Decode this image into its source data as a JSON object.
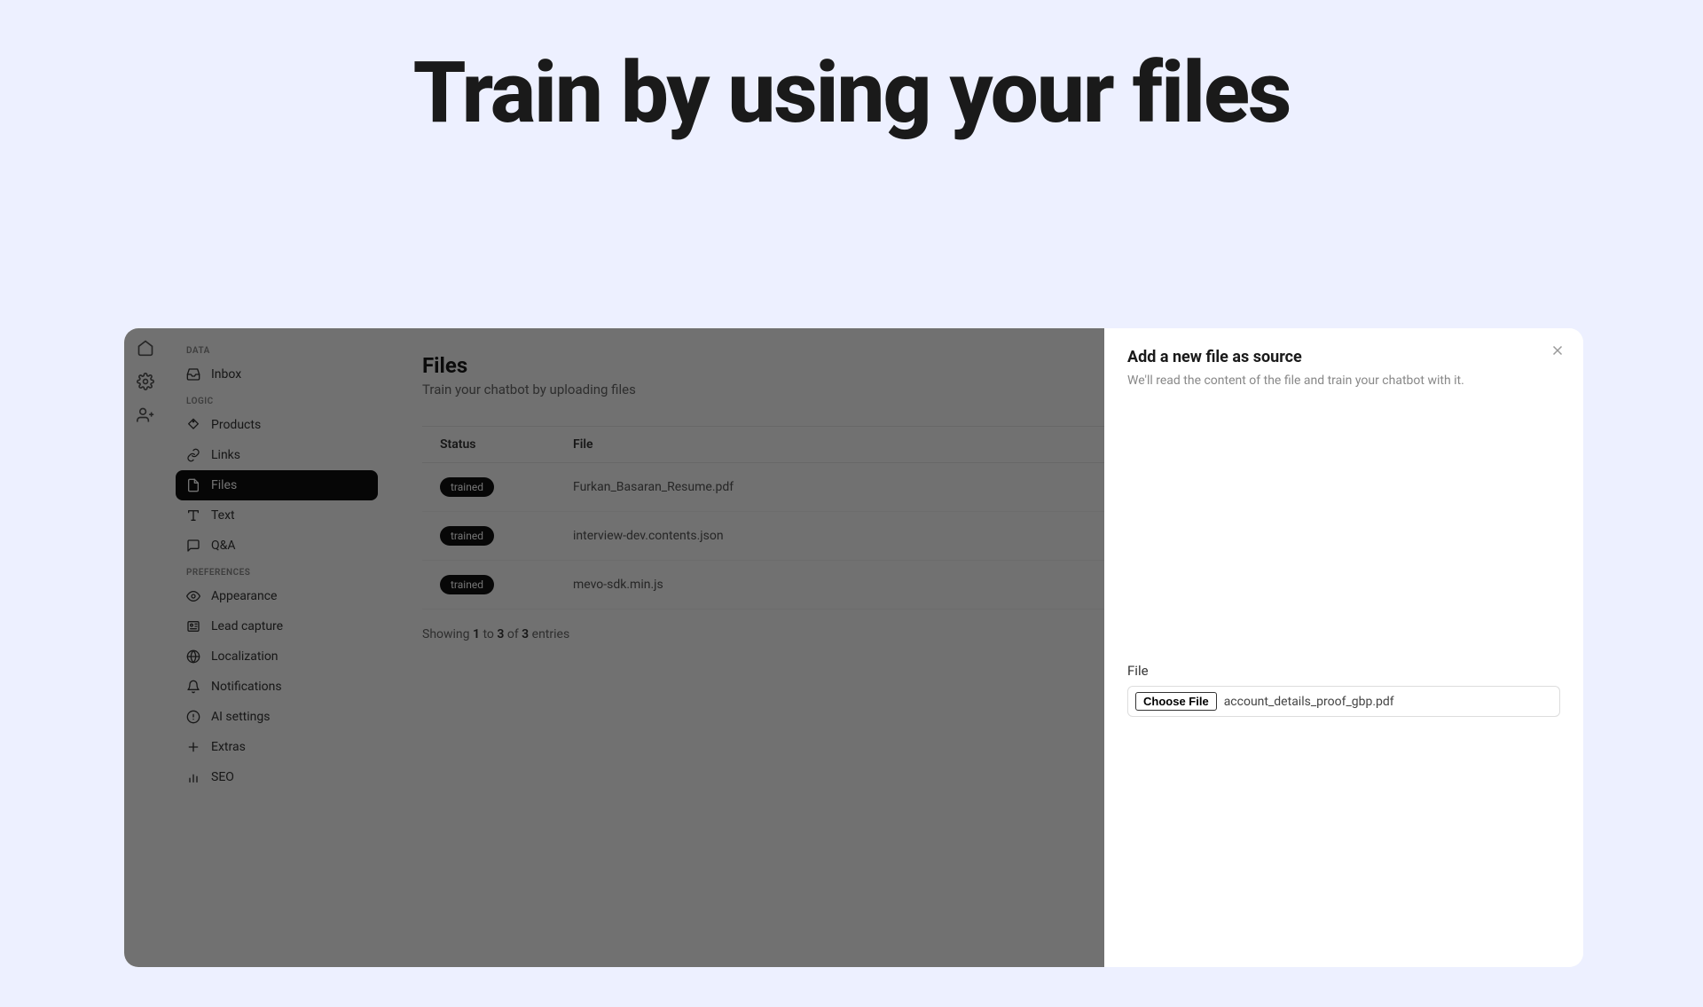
{
  "hero": {
    "title": "Train by using your files"
  },
  "rail": {
    "icons": [
      "home",
      "gear",
      "user-plus"
    ]
  },
  "sidebar": {
    "sections": [
      {
        "label": "DATA",
        "items": [
          {
            "icon": "inbox",
            "label": "Inbox",
            "active": false
          }
        ]
      },
      {
        "label": "LOGIC",
        "items": [
          {
            "icon": "tag",
            "label": "Products",
            "active": false
          },
          {
            "icon": "link",
            "label": "Links",
            "active": false
          },
          {
            "icon": "file",
            "label": "Files",
            "active": true
          },
          {
            "icon": "type",
            "label": "Text",
            "active": false
          },
          {
            "icon": "chat",
            "label": "Q&A",
            "active": false
          }
        ]
      },
      {
        "label": "PREFERENCES",
        "items": [
          {
            "icon": "eye",
            "label": "Appearance",
            "active": false
          },
          {
            "icon": "id",
            "label": "Lead capture",
            "active": false
          },
          {
            "icon": "globe",
            "label": "Localization",
            "active": false
          },
          {
            "icon": "bell",
            "label": "Notifications",
            "active": false
          },
          {
            "icon": "ai",
            "label": "AI settings",
            "active": false
          },
          {
            "icon": "plus",
            "label": "Extras",
            "active": false
          },
          {
            "icon": "chart",
            "label": "SEO",
            "active": false
          }
        ]
      }
    ]
  },
  "main": {
    "title": "Files",
    "subtitle": "Train your chatbot by uploading files",
    "columns": {
      "status": "Status",
      "file": "File"
    },
    "rows": [
      {
        "status": "trained",
        "file": "Furkan_Basaran_Resume.pdf"
      },
      {
        "status": "trained",
        "file": "interview-dev.contents.json"
      },
      {
        "status": "trained",
        "file": "mevo-sdk.min.js"
      }
    ],
    "pagination": {
      "prefix": "Showing ",
      "from": "1",
      "mid1": " to ",
      "to": "3",
      "mid2": " of ",
      "total": "3",
      "suffix": " entries"
    }
  },
  "drawer": {
    "title": "Add a new file as source",
    "subtitle": "We'll read the content of the file and train your chatbot with it.",
    "file_label": "File",
    "choose_button": "Choose File",
    "chosen_filename": "account_details_proof_gbp.pdf"
  }
}
